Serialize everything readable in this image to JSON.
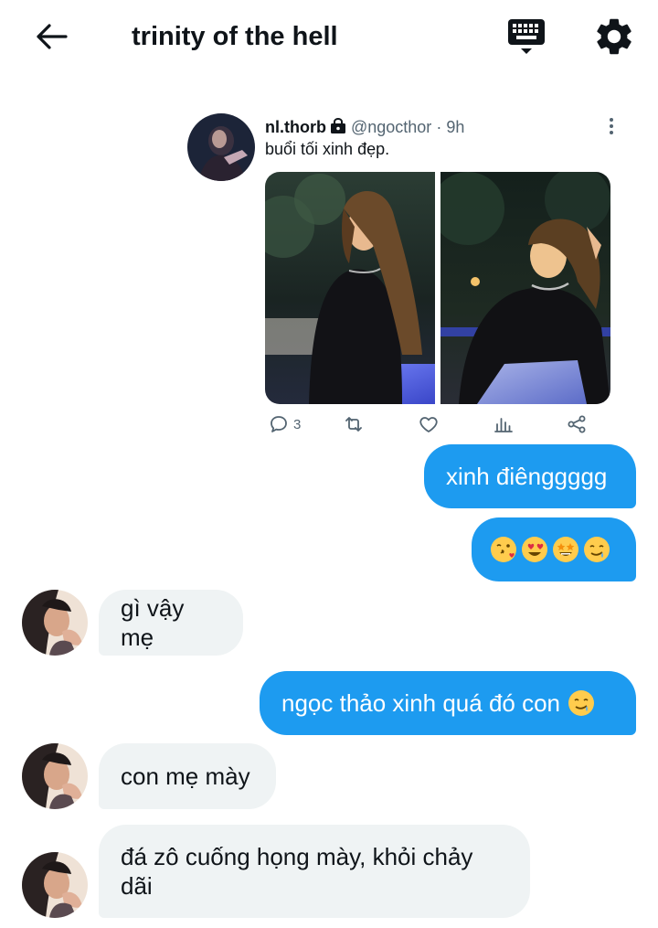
{
  "header": {
    "title": "trinity of the hell",
    "back_icon": "arrow-left-icon",
    "keyboard_icon": "keyboard-icon",
    "settings_icon": "gear-icon"
  },
  "tweet": {
    "display_name": "nl.thorb",
    "handle": "@ngocthor",
    "separator": "·",
    "time": "9h",
    "text": "buổi tối xinh đẹp.",
    "replies": "3",
    "photos": [
      "photo-1",
      "photo-2"
    ]
  },
  "messages": [
    {
      "side": "sent",
      "text": "xinh điênggggg"
    },
    {
      "side": "sent",
      "emojis": [
        "face-blowing-kiss",
        "heart-eyes",
        "star-struck",
        "drooling-face"
      ]
    },
    {
      "side": "received",
      "text": "gì vậy mẹ"
    },
    {
      "side": "sent",
      "text": "ngọc thảo xinh quá đó con",
      "emoji": "drooling-face"
    },
    {
      "side": "received",
      "text": "con mẹ mày"
    },
    {
      "side": "received",
      "line1": "đá zô cuống họng mày, khỏi chảy",
      "line2": "dãi"
    }
  ],
  "colors": {
    "accent": "#1d9bf0",
    "received_bubble": "#eff3f4",
    "text": "#0f1419",
    "muted": "#536471"
  }
}
